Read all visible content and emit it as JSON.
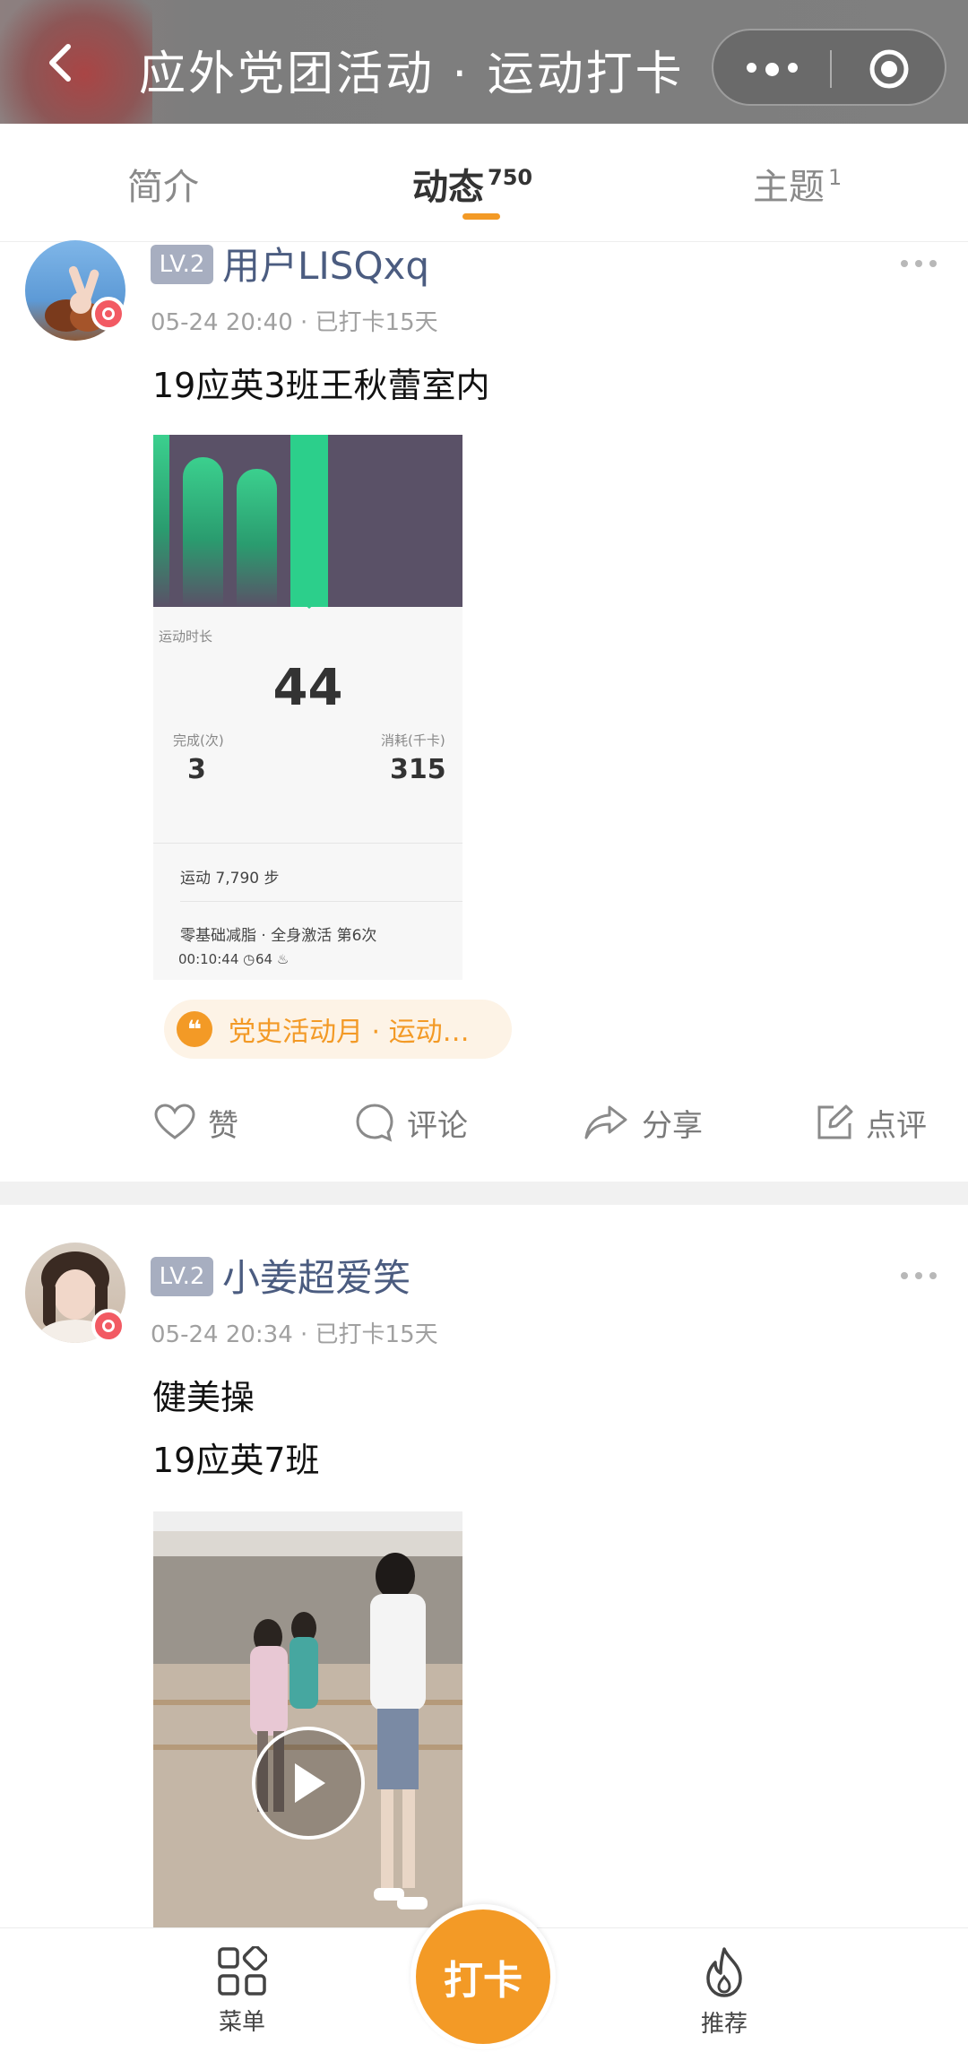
{
  "header": {
    "title": "应外党团活动 · 运动打卡",
    "back_icon": "chevron-left-icon",
    "more_icon": "more-dots-icon",
    "close_icon": "target-circle-icon"
  },
  "tabs": [
    {
      "label": "简介",
      "count": ""
    },
    {
      "label": "动态",
      "count": "750"
    },
    {
      "label": "主题",
      "count": "1"
    }
  ],
  "posts": [
    {
      "level": "LV.2",
      "username": "用户LISQxq",
      "meta": "05-24 20:40 · 已打卡15天",
      "lines": [
        "19应英3班王秋蕾室内"
      ],
      "fitness": {
        "duration_label": "运动时长",
        "duration_value": "44",
        "completed_label": "完成(次)",
        "completed_value": "3",
        "calories_label": "消耗(千卡)",
        "calories_value": "315",
        "steps_text": "运动 7,790 步",
        "course_text": "零基础减脂 · 全身激活 第6次",
        "course_time": "00:10:44",
        "course_cal": "64"
      },
      "topic": "党史活动月 · 运动…",
      "actions": [
        {
          "label": "赞",
          "icon": "heart-icon"
        },
        {
          "label": "评论",
          "icon": "comment-icon"
        },
        {
          "label": "分享",
          "icon": "share-icon"
        },
        {
          "label": "点评",
          "icon": "edit-icon"
        }
      ]
    },
    {
      "level": "LV.2",
      "username": "小姜超爱笑",
      "meta": "05-24 20:34 · 已打卡15天",
      "lines": [
        "健美操",
        "19应英7班"
      ]
    }
  ],
  "bottom_nav": {
    "menu_label": "菜单",
    "checkin_label": "打卡",
    "recommend_label": "推荐"
  },
  "colors": {
    "accent": "#f39a26",
    "username": "#4b5c80",
    "level_badge": "#a7aec0"
  }
}
